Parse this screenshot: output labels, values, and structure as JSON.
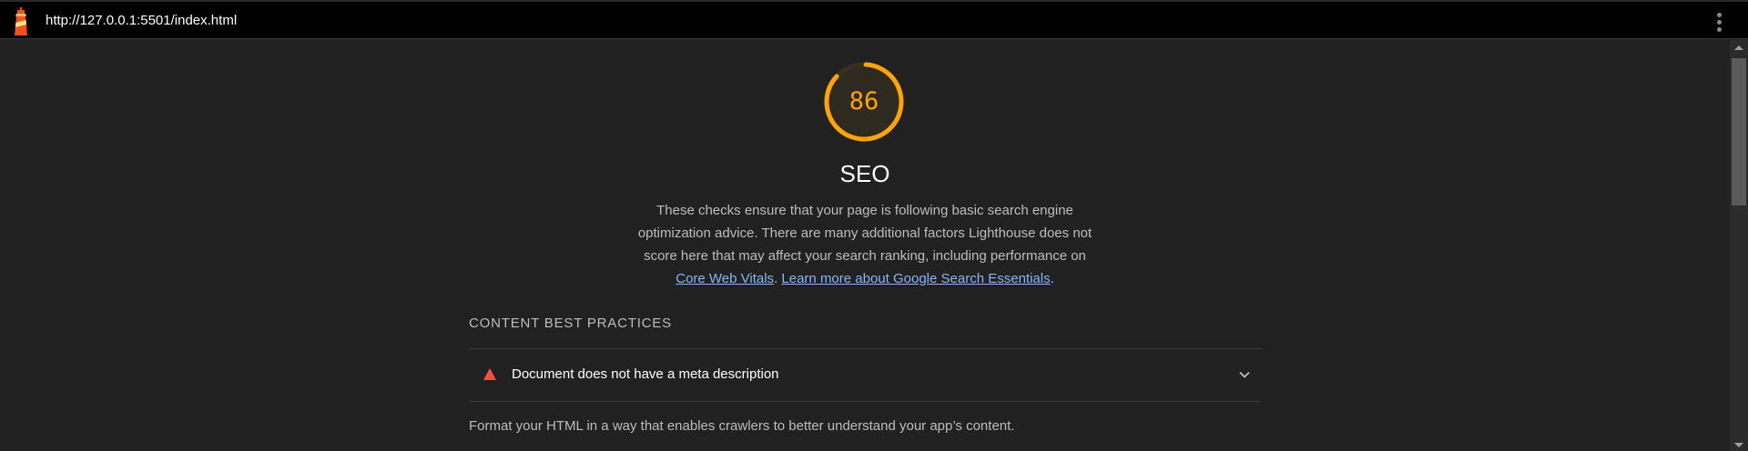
{
  "header": {
    "url": "http://127.0.0.1:5501/index.html",
    "logo_icon": "lighthouse-icon",
    "menu_icon": "vertical-dots-icon"
  },
  "gauge": {
    "score": "86",
    "score_fraction": 0.86,
    "color": "#ffa400"
  },
  "category": {
    "title": "SEO",
    "description_text": "These checks ensure that your page is following basic search engine optimization advice. There are many additional factors Lighthouse does not score here that may affect your search ranking, including performance on ",
    "link1": "Core Web Vitals",
    "separator": ". ",
    "link2": "Learn more about Google Search Essentials",
    "end": "."
  },
  "group": {
    "title": "CONTENT BEST PRACTICES",
    "audits": [
      {
        "title": "Document does not have a meta description",
        "status_icon": "fail-triangle-icon",
        "status_color": "#ff4e42",
        "expand_icon": "chevron-down-icon"
      }
    ],
    "description": "Format your HTML in a way that enables crawlers to better understand your app’s content."
  }
}
